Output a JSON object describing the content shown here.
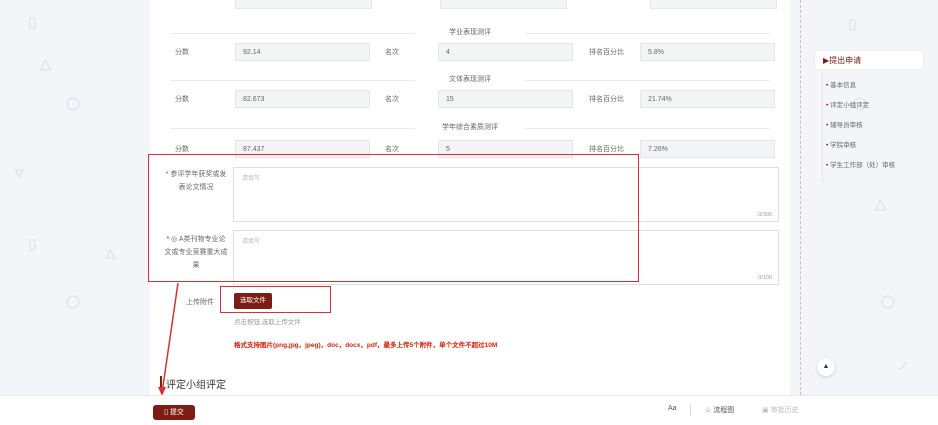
{
  "scores": {
    "academic": {
      "title": "学业表现测评",
      "score_label": "分数",
      "score": "92.14",
      "rank_label": "名次",
      "rank": "4",
      "percent_label": "排名百分比",
      "percent": "5.8%"
    },
    "sports": {
      "title": "文体表现测评",
      "score_label": "分数",
      "score": "82.673",
      "rank_label": "名次",
      "rank": "15",
      "percent_label": "排名百分比",
      "percent": "21.74%"
    },
    "overall": {
      "title": "学年综合素质测评",
      "score_label": "分数",
      "score": "87.437",
      "rank_label": "名次",
      "rank": "5",
      "percent_label": "排名百分比",
      "percent": "7.26%"
    }
  },
  "form": {
    "awards": {
      "required_mark": "*",
      "label_line1": "参评学年获奖或发",
      "label_line2": "表论文情况",
      "placeholder": "请填写",
      "count": "0/300"
    },
    "papers": {
      "required_mark": "*",
      "label_line1": "◎ A类刊物专业论",
      "label_line2": "文或专业竞赛重大成",
      "label_line3": "果",
      "placeholder": "请填写",
      "count": "0/100"
    },
    "upload": {
      "label": "上传附件",
      "button": "选取文件",
      "hint": "点击按钮,选取上传文件",
      "warning": "格式支持图片(png,jpg，jpeg)，doc，docx，pdf，最多上传5个附件，单个文件不超过10M"
    }
  },
  "eval_section": {
    "title": "评定小组评定"
  },
  "sidebar": {
    "head": "▶提出申请",
    "items": [
      "基本信息",
      "评定小组评定",
      "辅导员审核",
      "学院审核",
      "学生工作部（处）审核"
    ]
  },
  "bottom": {
    "submit": "提交",
    "font": "Aa",
    "flow": "流程图",
    "history": "审批历史"
  },
  "float": {
    "top_label": "▲"
  }
}
